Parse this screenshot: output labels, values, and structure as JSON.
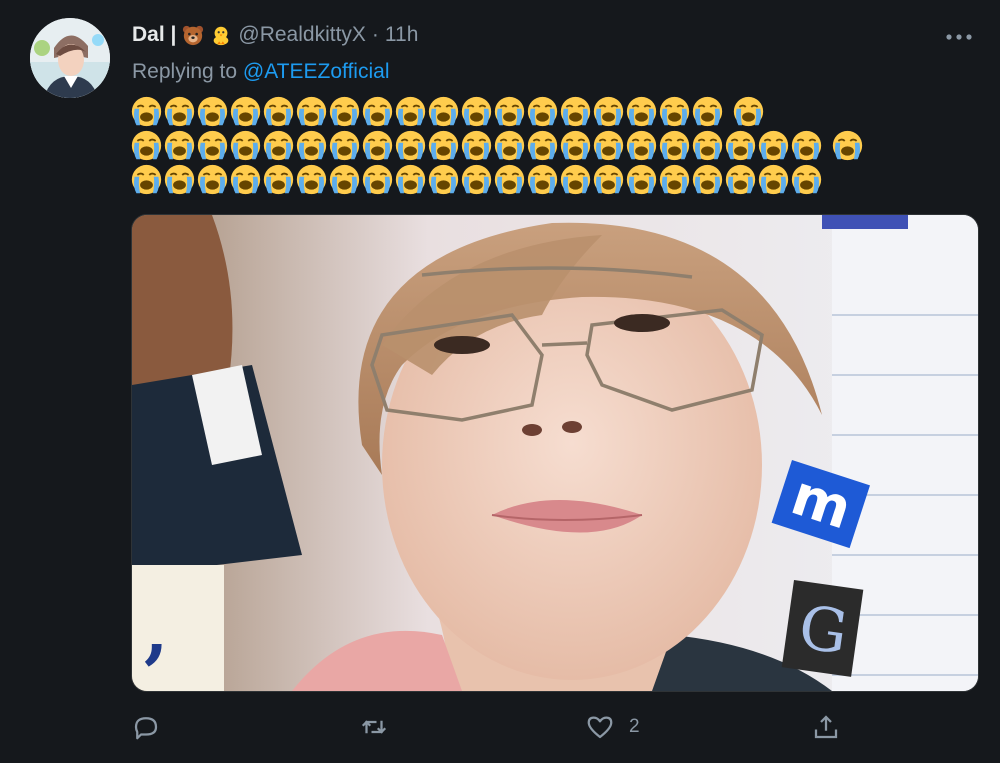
{
  "author": {
    "display_name": "Dal |",
    "badges": [
      "bear-face-emoji",
      "hatching-chick-emoji"
    ],
    "handle": "@RealdkittyX",
    "separator": "·",
    "time": "11h"
  },
  "reply": {
    "prefix": "Replying to",
    "mention": "@ATEEZofficial"
  },
  "content": {
    "emoji_name": "loudly-crying-face-emoji",
    "rows": [
      {
        "count": 18,
        "trailing": 1
      },
      {
        "count": 21,
        "trailing": 1
      },
      {
        "count": 21,
        "trailing": 0
      }
    ]
  },
  "media": {
    "kind": "photo",
    "description_icon": "photo-icon",
    "cutout_letters": [
      "m",
      "G",
      ","
    ]
  },
  "actions": {
    "reply_icon": "reply-icon",
    "retweet_icon": "retweet-icon",
    "like_icon": "heart-icon",
    "like_count": "2",
    "share_icon": "share-icon"
  },
  "menu_icon": "more-dots-icon",
  "colors": {
    "background": "#15181c",
    "accent": "#1d9bf0",
    "secondary_text": "#8b98a5",
    "primary_text": "#e7e9ea"
  }
}
